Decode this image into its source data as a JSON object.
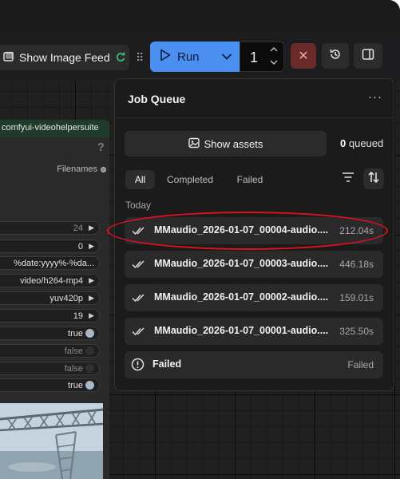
{
  "toolbar": {
    "feed_label": "Show Image Feed",
    "run_label": "Run",
    "batch_count": "1"
  },
  "node": {
    "title": "comfyui-videohelpersuite",
    "help": "?",
    "output_label": "Filenames",
    "widgets": [
      {
        "value": "24",
        "dim": true
      },
      {
        "value": "0",
        "dim": false
      },
      {
        "value": "%date:yyyy%-%da...",
        "dim": false
      },
      {
        "value": "video/h264-mp4",
        "dim": false
      },
      {
        "value": "yuv420p",
        "dim": false
      },
      {
        "value": "19",
        "dim": false
      },
      {
        "value": "true",
        "dim": false
      },
      {
        "value": "false",
        "dim": true
      },
      {
        "value": "false",
        "dim": true
      },
      {
        "value": "true",
        "dim": false
      }
    ]
  },
  "queue": {
    "title": "Job Queue",
    "show_assets_label": "Show assets",
    "queued_count": "0",
    "queued_label": "queued",
    "tabs": [
      "All",
      "Completed",
      "Failed"
    ],
    "section": "Today",
    "jobs": [
      {
        "name": "MMaudio_2026-01-07_00004-audio....",
        "time": "212.04s"
      },
      {
        "name": "MMaudio_2026-01-07_00003-audio....",
        "time": "446.18s"
      },
      {
        "name": "MMaudio_2026-01-07_00002-audio....",
        "time": "159.01s"
      },
      {
        "name": "MMaudio_2026-01-07_00001-audio....",
        "time": "325.50s"
      }
    ],
    "failed_job": {
      "name": "Failed",
      "status": "Failed"
    }
  },
  "colors": {
    "run_accent": "#4b8ff0",
    "cancel": "#6b2a2a",
    "annotation": "#e01020",
    "node_title_bg": "#1f3b2b"
  }
}
